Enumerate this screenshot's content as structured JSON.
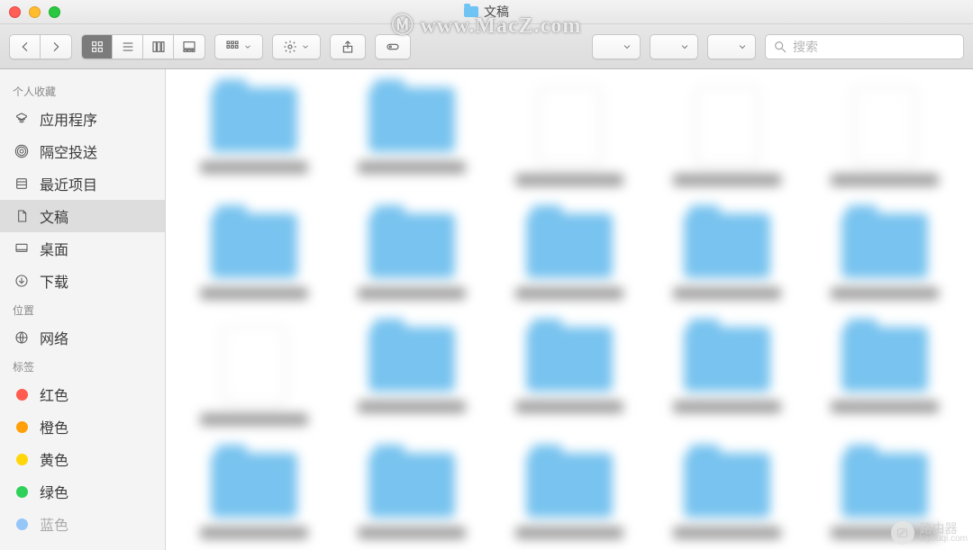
{
  "window": {
    "title": "文稿"
  },
  "watermark": "Ⓜ www.MacZ.com",
  "toolbar": {
    "search_placeholder": "搜索"
  },
  "sidebar": {
    "sections": [
      {
        "heading": "个人收藏",
        "items": [
          {
            "icon": "apps",
            "label": "应用程序"
          },
          {
            "icon": "airdrop",
            "label": "隔空投送"
          },
          {
            "icon": "recents",
            "label": "最近项目"
          },
          {
            "icon": "doc",
            "label": "文稿",
            "selected": true
          },
          {
            "icon": "desktop",
            "label": "桌面"
          },
          {
            "icon": "download",
            "label": "下载"
          }
        ]
      },
      {
        "heading": "位置",
        "items": [
          {
            "icon": "network",
            "label": "网络"
          }
        ]
      },
      {
        "heading": "标签",
        "items": [
          {
            "icon": "tag",
            "color": "#ff5b4f",
            "label": "红色"
          },
          {
            "icon": "tag",
            "color": "#ff9f0a",
            "label": "橙色"
          },
          {
            "icon": "tag",
            "color": "#ffd60a",
            "label": "黄色"
          },
          {
            "icon": "tag",
            "color": "#30d158",
            "label": "绿色"
          },
          {
            "icon": "tag",
            "color": "#0a84ff",
            "label": "蓝色"
          }
        ]
      }
    ]
  },
  "grid": [
    [
      "folder",
      "folder",
      "file",
      "file",
      "file"
    ],
    [
      "folder",
      "folder",
      "folder",
      "folder",
      "folder"
    ],
    [
      "file",
      "folder",
      "folder",
      "folder",
      "folder"
    ],
    [
      "folder",
      "folder",
      "folder",
      "folder",
      "folder"
    ]
  ],
  "corner_badge": {
    "text": "路由器",
    "sub": "luyouqi.com"
  }
}
